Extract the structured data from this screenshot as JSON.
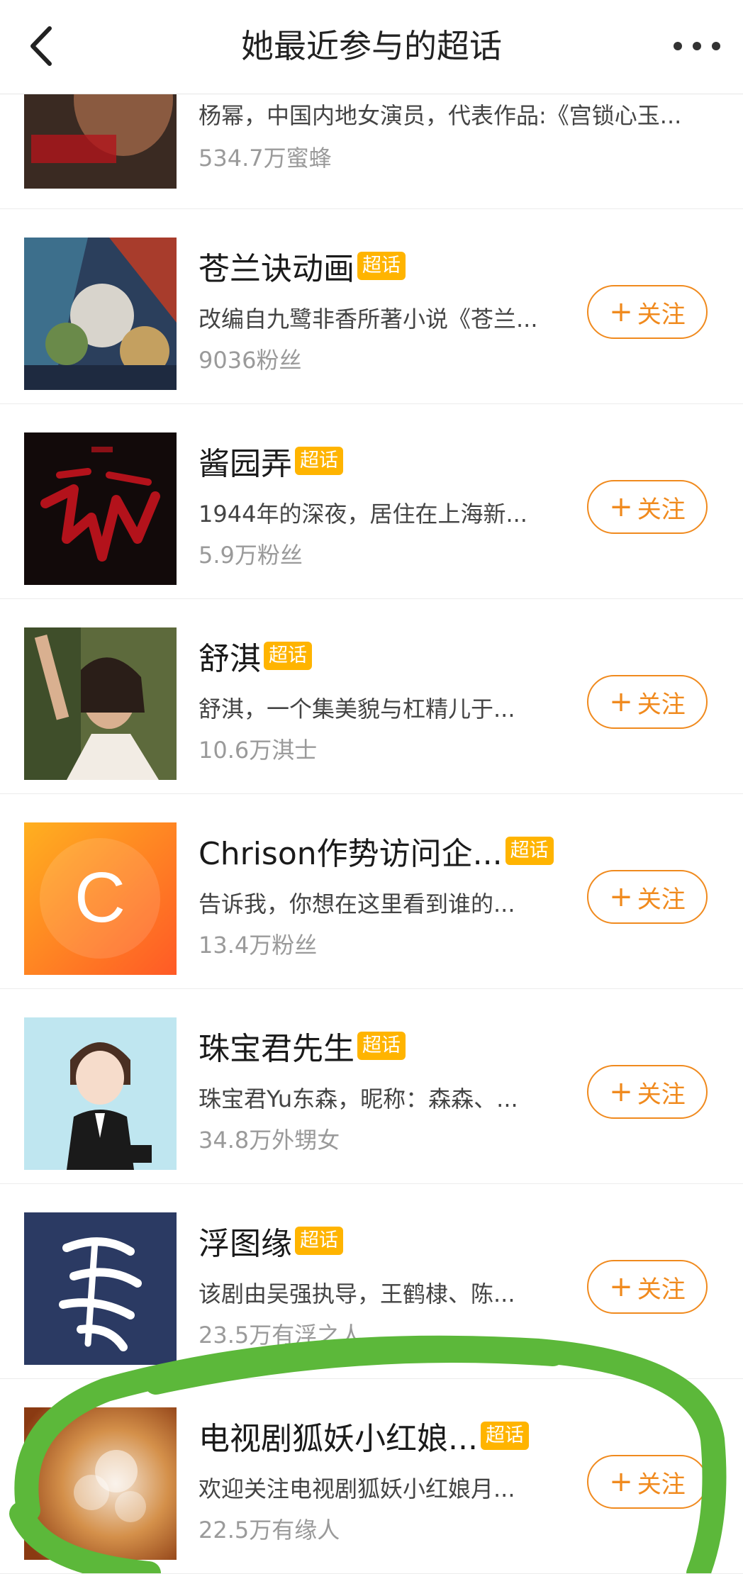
{
  "header": {
    "title": "她最近参与的超话",
    "back_icon": "chevron-left-icon",
    "more_icon": "more-dots-icon"
  },
  "badge_label": "超话",
  "follow_label": "关注",
  "items": [
    {
      "name": "",
      "desc": "杨幂，中国内地女演员，代表作品:《宫锁心玉...",
      "fans": "534.7万蜜蜂",
      "has_badge": false,
      "has_follow": false
    },
    {
      "name": "苍兰诀动画",
      "desc": "改编自九鹭非香所著小说《苍兰...",
      "fans": "9036粉丝",
      "has_badge": true,
      "has_follow": true
    },
    {
      "name": "酱园弄",
      "desc": "1944年的深夜，居住在上海新...",
      "fans": "5.9万粉丝",
      "has_badge": true,
      "has_follow": true
    },
    {
      "name": "舒淇",
      "desc": "舒淇，一个集美貌与杠精儿于...",
      "fans": "10.6万淇士",
      "has_badge": true,
      "has_follow": true
    },
    {
      "name": "Chrison作势访问企...",
      "desc": "告诉我，你想在这里看到谁的...",
      "fans": "13.4万粉丝",
      "has_badge": true,
      "has_follow": true
    },
    {
      "name": "珠宝君先生",
      "desc": "珠宝君Yu东森，昵称：森森、...",
      "fans": "34.8万外甥女",
      "has_badge": true,
      "has_follow": true
    },
    {
      "name": "浮图缘",
      "desc": "该剧由吴强执导，王鹤棣、陈...",
      "fans": "23.5万有浮之人",
      "has_badge": true,
      "has_follow": true
    },
    {
      "name": "电视剧狐妖小红娘...",
      "desc": "欢迎关注电视剧狐妖小红娘月...",
      "fans": "22.5万有缘人",
      "has_badge": true,
      "has_follow": true
    }
  ],
  "thumb_texts": {
    "orange_letter": "C"
  },
  "colors": {
    "accent": "#f08a1e",
    "badge": "#ffb400",
    "highlight": "#5cb83a"
  }
}
